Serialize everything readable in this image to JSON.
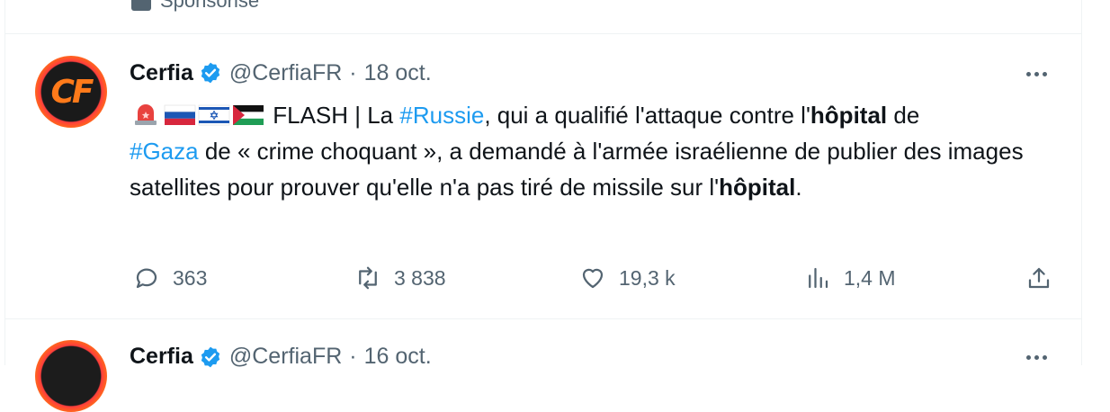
{
  "previous_tweet": {
    "sponsored_label": "Sponsorisé"
  },
  "tweet": {
    "author_name": "Cerfia",
    "handle": "@CerfiaFR",
    "separator": "·",
    "date": "18 oct.",
    "avatar_text": "CF",
    "flags": [
      "siren-emoji",
      "russia-flag",
      "israel-flag",
      "palestine-flag"
    ],
    "text_parts": {
      "p1": " FLASH | La ",
      "hashtag1": "#Russie",
      "p2": ", qui a qualifié l'attaque contre l'",
      "bold1": "hôpital",
      "p3": " de ",
      "hashtag2": "#Gaza",
      "p4": " de « crime choquant », a demandé à l'armée israélienne de publier des images satellites pour prouver qu'elle n'a pas tiré de missile sur l'",
      "bold2": "hôpital",
      "p5": "."
    },
    "stats": {
      "replies": "363",
      "reposts": "3 838",
      "likes": "19,3 k",
      "views": "1,4 M"
    }
  },
  "next_tweet": {
    "author_name": "Cerfia",
    "handle": "@CerfiaFR",
    "separator": "·",
    "date": "16 oct."
  },
  "colors": {
    "accent": "#1d9bf0",
    "secondary_text": "#536471",
    "border": "#eff3f4"
  }
}
